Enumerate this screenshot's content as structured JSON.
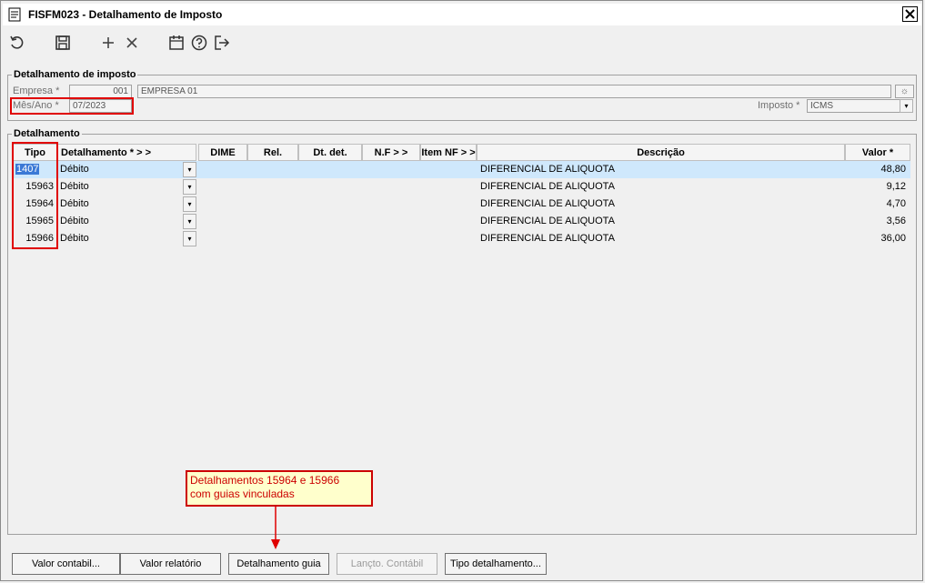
{
  "window": {
    "title": "FISFM023 - Detalhamento de Imposto"
  },
  "toolbar": {
    "icons": [
      "undo-icon",
      "save-icon",
      "add-icon",
      "delete-icon",
      "calendar-icon",
      "help-icon",
      "exit-icon"
    ]
  },
  "header_section": {
    "legend": "Detalhamento de imposto",
    "empresa_label": "Empresa *",
    "empresa_code": "001",
    "empresa_name": "EMPRESA 01",
    "mesano_label": "Mês/Ano *",
    "mesano_value": "07/2023",
    "imposto_label": "Imposto *",
    "imposto_value": "ICMS"
  },
  "detail_section": {
    "legend": "Detalhamento",
    "columns": [
      "Tipo",
      "Detalhamento *  > >",
      "DIME",
      "Rel.",
      "Dt. det.",
      "N.F  > >",
      "Item NF > >",
      "Descrição",
      "Valor *"
    ],
    "rows": [
      {
        "tipo": "1407",
        "detalhamento": "Débito",
        "descricao": "DIFERENCIAL DE ALIQUOTA",
        "valor": "48,80"
      },
      {
        "tipo": "15963",
        "detalhamento": "Débito",
        "descricao": "DIFERENCIAL DE ALIQUOTA",
        "valor": "9,12"
      },
      {
        "tipo": "15964",
        "detalhamento": "Débito",
        "descricao": "DIFERENCIAL DE ALIQUOTA",
        "valor": "4,70"
      },
      {
        "tipo": "15965",
        "detalhamento": "Débito",
        "descricao": "DIFERENCIAL DE ALIQUOTA",
        "valor": "3,56"
      },
      {
        "tipo": "15966",
        "detalhamento": "Débito",
        "descricao": "DIFERENCIAL DE ALIQUOTA",
        "valor": "36,00"
      }
    ]
  },
  "callout": {
    "line1": "Detalhamentos 15964 e 15966",
    "line2": "com guias vinculadas"
  },
  "buttons": {
    "valor_contabil": "Valor contabil...",
    "valor_relatorio": "Valor relatório",
    "detalhamento_guia": "Detalhamento guia",
    "lancto_contabil": "Lançto. Contábil",
    "tipo_detalhamento": "Tipo detalhamento..."
  },
  "colors": {
    "highlight": "#cfe8fc",
    "selection": "#3b79d6",
    "annotation": "#e00000",
    "callout_bg": "#ffffcc"
  }
}
